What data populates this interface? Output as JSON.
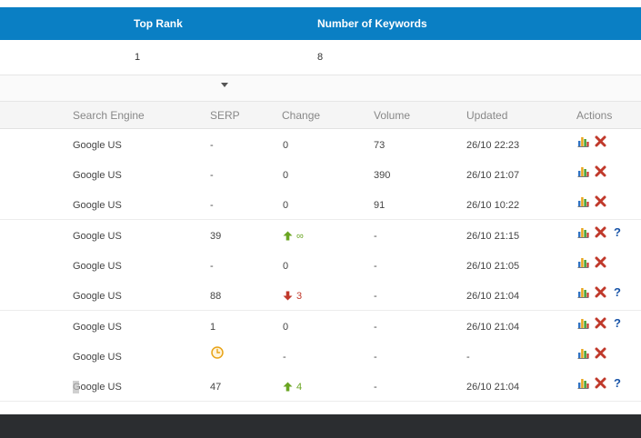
{
  "summary": {
    "headers": {
      "top_rank": "Top Rank",
      "number_of_keywords": "Number of Keywords"
    },
    "values": {
      "top_rank": "1",
      "number_of_keywords": "8"
    }
  },
  "table": {
    "columns": {
      "search_engine": "Search Engine",
      "serp": "SERP",
      "change": "Change",
      "volume": "Volume",
      "updated": "Updated",
      "actions": "Actions"
    },
    "rows": [
      {
        "engine": "Google US",
        "serp": "-",
        "change": "0",
        "change_dir": "none",
        "volume": "73",
        "updated": "26/10 22:23",
        "help": false,
        "pending": false
      },
      {
        "engine": "Google US",
        "serp": "-",
        "change": "0",
        "change_dir": "none",
        "volume": "390",
        "updated": "26/10 21:07",
        "help": false,
        "pending": false
      },
      {
        "engine": "Google US",
        "serp": "-",
        "change": "0",
        "change_dir": "none",
        "volume": "91",
        "updated": "26/10 10:22",
        "help": false,
        "pending": false
      },
      {
        "engine": "Google US",
        "serp": "39",
        "change": "∞",
        "change_dir": "up",
        "volume": "-",
        "updated": "26/10 21:15",
        "help": true,
        "pending": false
      },
      {
        "engine": "Google US",
        "serp": "-",
        "change": "0",
        "change_dir": "none",
        "volume": "-",
        "updated": "26/10 21:05",
        "help": false,
        "pending": false
      },
      {
        "engine": "Google US",
        "serp": "88",
        "change": "3",
        "change_dir": "down",
        "volume": "-",
        "updated": "26/10 21:04",
        "help": true,
        "pending": false
      },
      {
        "engine": "Google US",
        "serp": "1",
        "change": "0",
        "change_dir": "none",
        "volume": "-",
        "updated": "26/10 21:04",
        "help": true,
        "pending": false
      },
      {
        "engine": "Google US",
        "serp": "",
        "change": "-",
        "change_dir": "none",
        "volume": "-",
        "updated": "-",
        "help": false,
        "pending": true
      },
      {
        "engine": "Google US",
        "serp": "47",
        "change": "4",
        "change_dir": "up",
        "volume": "-",
        "updated": "26/10 21:04",
        "help": true,
        "pending": false
      }
    ]
  },
  "icons": {
    "chart": "bar-chart-icon",
    "delete": "delete-x-icon",
    "help": "help-question-icon",
    "pending": "clock-icon",
    "dropdown": "caret-down-icon"
  },
  "help_glyph": "?",
  "colors": {
    "header_bg": "#0a7fc4",
    "up": "#6aa522",
    "down": "#c0392b",
    "delete": "#c0392b",
    "help": "#1a55a8",
    "footer": "#2b2d30"
  }
}
